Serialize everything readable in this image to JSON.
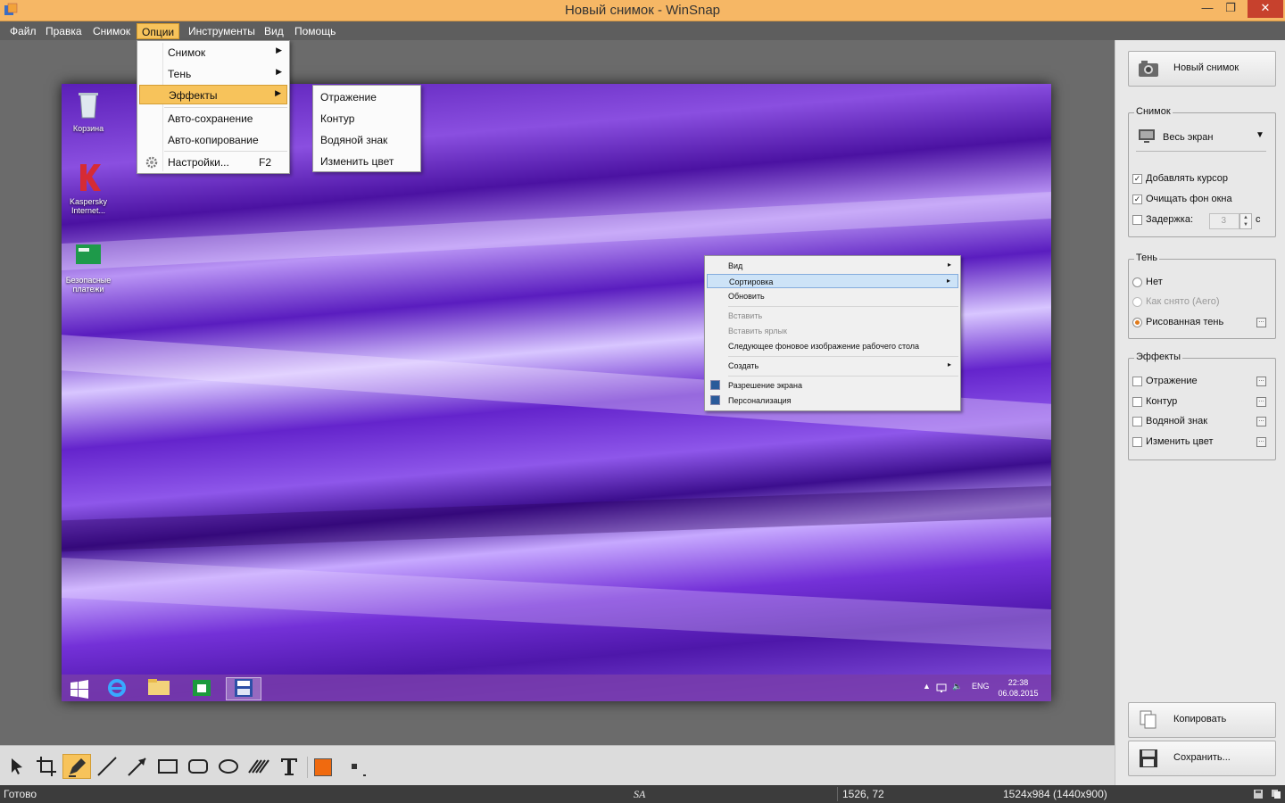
{
  "window": {
    "title": "Новый снимок - WinSnap",
    "min_glyph": "—",
    "max_glyph": "❐",
    "close_glyph": "✕"
  },
  "menubar": {
    "items": [
      "Файл",
      "Правка",
      "Снимок",
      "Опции",
      "Инструменты",
      "Вид",
      "Помощь"
    ]
  },
  "options_menu": {
    "items": [
      {
        "label": "Снимок",
        "submenu": true
      },
      {
        "label": "Тень",
        "submenu": true
      },
      {
        "label": "Эффекты",
        "submenu": true,
        "highlighted": true
      },
      {
        "label": "Авто-сохранение"
      },
      {
        "label": "Авто-копирование"
      },
      {
        "label": "Настройки...",
        "shortcut": "F2",
        "icon": "gear-icon"
      }
    ]
  },
  "effects_submenu": {
    "items": [
      "Отражение",
      "Контур",
      "Водяной знак",
      "Изменить цвет"
    ]
  },
  "screenshot": {
    "desktop_icons": [
      {
        "label": "Корзина",
        "icon": "recycle-bin-icon"
      },
      {
        "label": "Kaspersky Internet...",
        "icon": "kaspersky-icon"
      },
      {
        "label": "Безопасные платежи",
        "icon": "safe-money-icon"
      }
    ],
    "context_menu": {
      "items": [
        {
          "label": "Вид",
          "submenu": true
        },
        {
          "label": "Сортировка",
          "submenu": true,
          "highlighted": true
        },
        {
          "label": "Обновить"
        },
        {
          "label": "Вставить",
          "disabled": true
        },
        {
          "label": "Вставить ярлык",
          "disabled": true
        },
        {
          "label": "Следующее фоновое изображение рабочего стола"
        },
        {
          "label": "Создать",
          "submenu": true
        },
        {
          "label": "Разрешение экрана",
          "icon": "display-icon"
        },
        {
          "label": "Персонализация",
          "icon": "personalize-icon"
        }
      ]
    },
    "taskbar": {
      "lang": "ENG",
      "time": "22:38",
      "date": "06.08.2015",
      "tray_glyphs": {
        "up": "▲",
        "volume": "🔈"
      }
    }
  },
  "right_panel": {
    "new_snapshot_button": "Новый снимок",
    "snapshot_group": {
      "title": "Снимок",
      "mode": "Весь экран",
      "add_cursor": {
        "label": "Добавлять курсор",
        "checked": true
      },
      "clear_bg": {
        "label": "Очищать фон окна",
        "checked": true
      },
      "delay": {
        "label": "Задержка:",
        "checked": false,
        "value": "3",
        "unit": "с"
      }
    },
    "shadow_group": {
      "title": "Тень",
      "options": [
        {
          "label": "Нет",
          "selected": false,
          "disabled": false
        },
        {
          "label": "Как снято (Aero)",
          "selected": false,
          "disabled": true
        },
        {
          "label": "Рисованная тень",
          "selected": true,
          "disabled": false
        }
      ]
    },
    "effects_group": {
      "title": "Эффекты",
      "items": [
        {
          "label": "Отражение",
          "checked": false
        },
        {
          "label": "Контур",
          "checked": false
        },
        {
          "label": "Водяной знак",
          "checked": false
        },
        {
          "label": "Изменить цвет",
          "checked": false
        }
      ]
    },
    "copy_button": "Копировать",
    "save_button": "Сохранить..."
  },
  "toolbar": {
    "tools": [
      "select",
      "crop",
      "pen",
      "line",
      "arrow",
      "rectangle",
      "rounded-rectangle",
      "ellipse",
      "hatch",
      "text"
    ],
    "active_tool": "pen",
    "color": "#f06a0f"
  },
  "statusbar": {
    "status": "Готово",
    "tag": "SA",
    "coords": "1526, 72",
    "size": "1524x984 (1440x900)"
  },
  "colors": {
    "title_bar": "#f6b765",
    "menu_highlight": "#f7c35b",
    "close_button": "#c7412d",
    "accent_orange": "#f06a0f"
  }
}
